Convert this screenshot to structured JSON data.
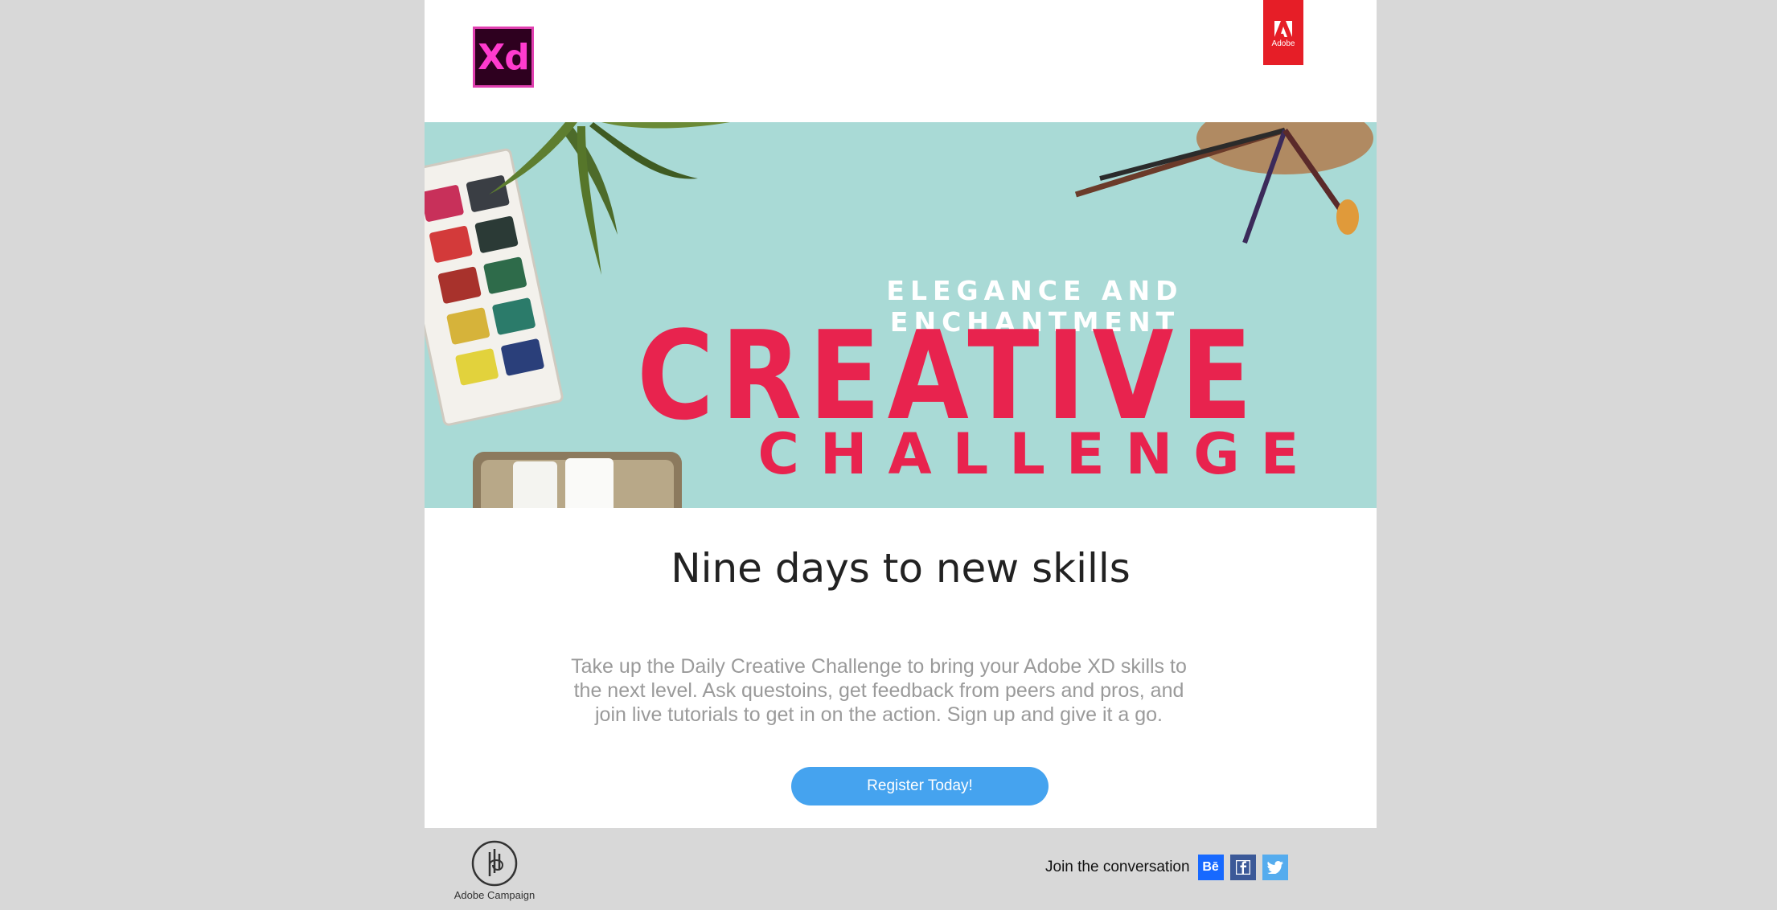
{
  "header": {
    "xd_logo_text": "Xd",
    "adobe_tag_text": "Adobe"
  },
  "hero": {
    "line1": "ELEGANCE AND ENCHANTMENT",
    "line2": "CREATIVE",
    "line3": "CHALLENGE"
  },
  "content": {
    "headline": "Nine days to new skills",
    "body": "Take up the Daily Creative Challenge to bring your Adobe XD skills to the next level. Ask questoins, get feedback from peers and pros, and join live tutorials to get in on the action. Sign up and give it a go.",
    "cta_label": "Register Today!"
  },
  "footer": {
    "campaign_label": "Adobe Campaign",
    "social_label": "Join the conversation",
    "social_icons": [
      "behance-icon",
      "facebook-icon",
      "twitter-icon"
    ],
    "behance_text": "Bē"
  },
  "colors": {
    "page_bg": "#d8d8d8",
    "hero_bg": "#a9dad6",
    "accent_red": "#e8234e",
    "cta_blue": "#45a3ef"
  }
}
